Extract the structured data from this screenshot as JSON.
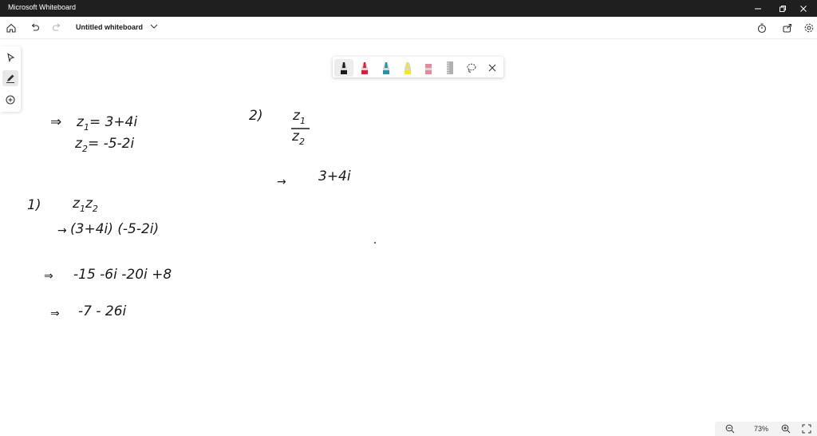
{
  "window": {
    "title": "Microsoft Whiteboard"
  },
  "appbar": {
    "document_title": "Untitled whiteboard"
  },
  "pen_colors": [
    "#1a1a1a",
    "#d4223b",
    "#2f8fa8",
    "#f2e52a",
    "#e58a9a",
    "#b0b0b0"
  ],
  "handwriting": {
    "given": {
      "implies": "⇒",
      "z1_var": "z",
      "z1_sub": "1",
      "z1_eq": "= 3+4i",
      "z2_var": "z",
      "z2_sub": "2",
      "z2_eq": "= -5-2i"
    },
    "part1": {
      "label": "1)",
      "expr_z": "z",
      "expr_sub1": "1",
      "expr_z2": "z",
      "expr_sub2": "2",
      "step1_arrow": "→",
      "step1": "(3+4i) (-5-2i)",
      "step2_arrow": "⇒",
      "step2": "-15 -6i -20i +8",
      "step3_arrow": "⇒",
      "step3": "-7 - 26i"
    },
    "part2": {
      "label": "2)",
      "num_var": "z",
      "num_sub": "1",
      "den_var": "z",
      "den_sub": "2",
      "step1_arrow": "→",
      "step1": "3+4i"
    }
  },
  "zoom": {
    "level": "73%"
  }
}
